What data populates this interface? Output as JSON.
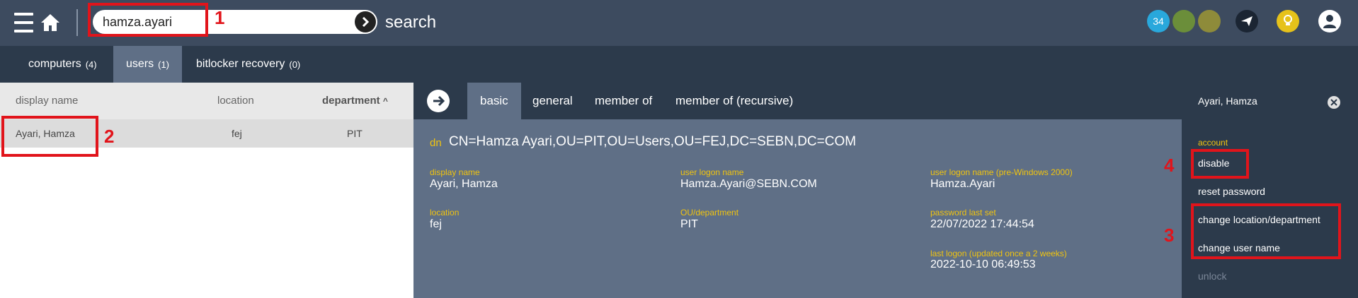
{
  "header": {
    "search_value": "hamza.ayari",
    "search_label": "search",
    "badge_count": "34",
    "circle_colors": [
      "#29a8dc",
      "#6b8e3a",
      "#8e8b3a"
    ],
    "annotations": [
      "1"
    ]
  },
  "tabs": [
    {
      "label": "computers",
      "count": "(4)"
    },
    {
      "label": "users",
      "count": "(1)"
    },
    {
      "label": "bitlocker recovery",
      "count": "(0)"
    }
  ],
  "list": {
    "columns": [
      "display name",
      "location",
      "department"
    ],
    "sort_indicator": "^",
    "rows": [
      {
        "display_name": "Ayari, Hamza",
        "location": "fej",
        "department": "PIT"
      }
    ],
    "annotation": "2"
  },
  "detail": {
    "tabs": [
      "basic",
      "general",
      "member of",
      "member of (recursive)"
    ],
    "dn_label": "dn",
    "dn_value": "CN=Hamza Ayari,OU=PIT,OU=Users,OU=FEJ,DC=SEBN,DC=COM",
    "fields": [
      {
        "label": "display name",
        "value": "Ayari, Hamza"
      },
      {
        "label": "user logon name",
        "value": "Hamza.Ayari@SEBN.COM"
      },
      {
        "label": "user logon name (pre-Windows 2000)",
        "value": "Hamza.Ayari"
      },
      {
        "label": "location",
        "value": "fej"
      },
      {
        "label": "OU/department",
        "value": "PIT"
      },
      {
        "label": "password last set",
        "value": "22/07/2022 17:44:54"
      },
      {
        "label": "last logon (updated once a 2 weeks)",
        "value": "2022-10-10 06:49:53"
      }
    ]
  },
  "actions": {
    "title": "Ayari, Hamza",
    "section": "account",
    "items": [
      "disable",
      "reset password",
      "change location/department",
      "change user name",
      "unlock"
    ],
    "annotations": [
      "4",
      "3"
    ]
  }
}
